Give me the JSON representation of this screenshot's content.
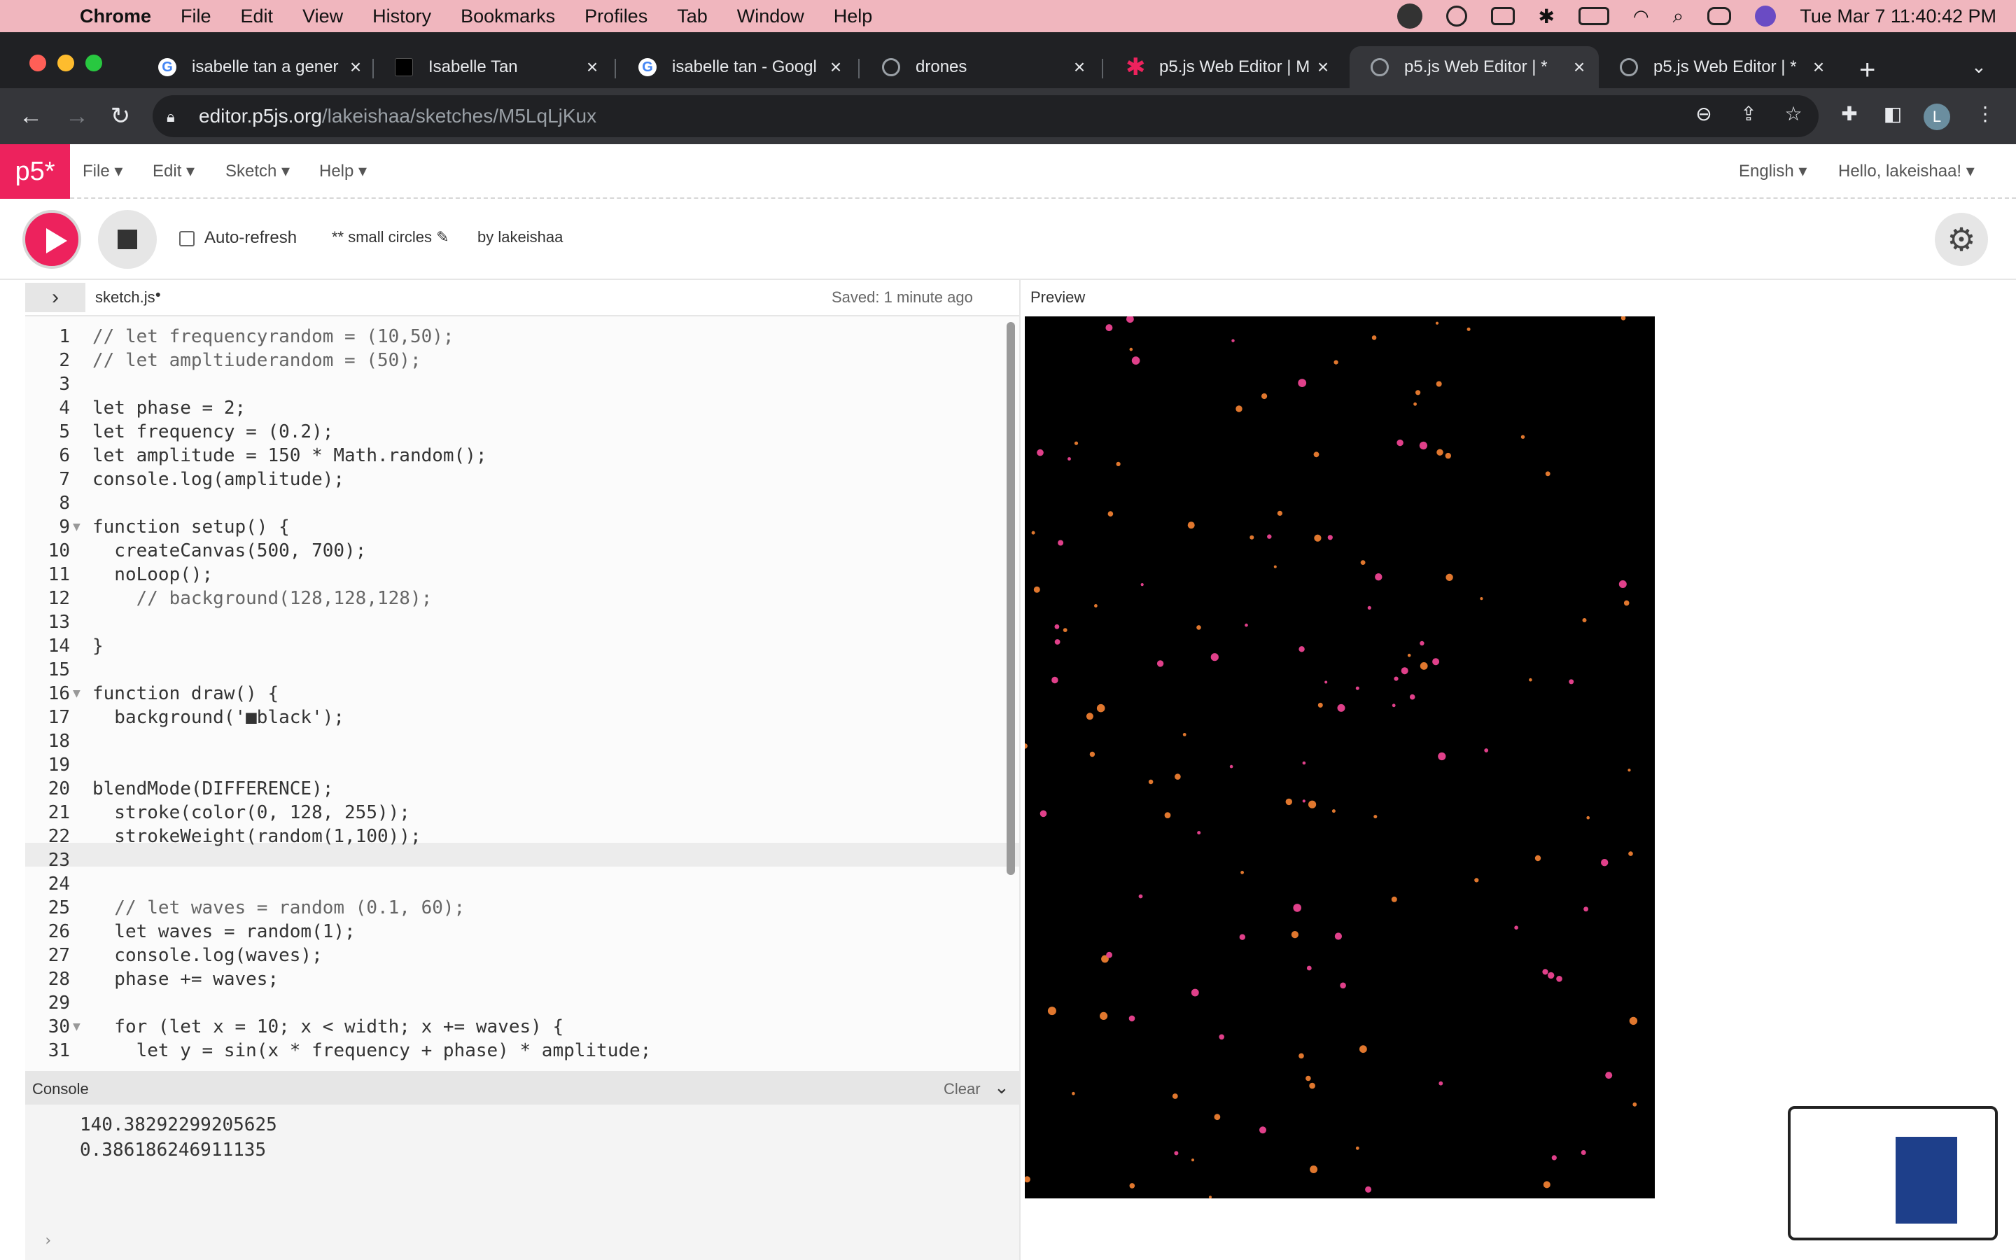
{
  "menubar": {
    "app": "Chrome",
    "items": [
      "File",
      "Edit",
      "View",
      "History",
      "Bookmarks",
      "Profiles",
      "Tab",
      "Window",
      "Help"
    ],
    "clock": "Tue Mar 7  11:40:42 PM"
  },
  "tabs": [
    {
      "title": "isabelle tan a gener",
      "icon": "google-icon",
      "color": "#ffffff"
    },
    {
      "title": "Isabelle Tan",
      "icon": "black-square-icon",
      "color": "#000000"
    },
    {
      "title": "isabelle tan - Googl",
      "icon": "google-icon",
      "color": "#ffffff"
    },
    {
      "title": "drones",
      "icon": "globe-icon",
      "color": "#9aa0a6"
    },
    {
      "title": "p5.js Web Editor | M",
      "icon": "p5-asterisk-icon",
      "color": "#ed225d"
    },
    {
      "title": "p5.js Web Editor | *",
      "icon": "globe-icon",
      "color": "#9aa0a6"
    },
    {
      "title": "p5.js Web Editor | *",
      "icon": "globe-icon",
      "color": "#9aa0a6"
    }
  ],
  "address": {
    "host": "editor.p5js.org",
    "path": "/lakeishaa/sketches/M5LqLjKux"
  },
  "avatar_letter": "L",
  "p5nav": {
    "logo": "p5*",
    "menus": [
      "File",
      "Edit",
      "Sketch",
      "Help"
    ],
    "language": "English",
    "greeting": "Hello, lakeishaa!"
  },
  "p5toolbar": {
    "auto_refresh": "Auto-refresh",
    "sketch_name": "** small circles",
    "byline": "by lakeishaa"
  },
  "editor": {
    "filename": "sketch.js",
    "saved": "Saved: 1 minute ago",
    "lines": [
      "// let frequencyrandom = (10,50);",
      "// let ampltiuderandom = (50);",
      "",
      "let phase = 2;",
      "let frequency = (0.2);",
      "let amplitude = 150 * Math.random();",
      "console.log(amplitude);",
      "",
      "function setup() {",
      "  createCanvas(500, 700);",
      "  noLoop();",
      "    // background(128,128,128);",
      "",
      "}",
      "",
      "function draw() {",
      "  background('■black');",
      "",
      "",
      "blendMode(DIFFERENCE);",
      "  stroke(color(0, 128, 255));",
      "  strokeWeight(random(1,100));",
      "",
      "",
      "  // let waves = random (0.1, 60);",
      "  let waves = random(1);",
      "  console.log(waves);",
      "  phase += waves;",
      "",
      "  for (let x = 10; x < width; x += waves) {",
      "    let y = sin(x * frequency + phase) * amplitude;"
    ]
  },
  "console": {
    "title": "Console",
    "clear": "Clear",
    "lines": [
      "140.38292299205625",
      "0.386186246911135"
    ]
  },
  "preview": {
    "label": "Preview",
    "background": "#3d7ef0"
  }
}
